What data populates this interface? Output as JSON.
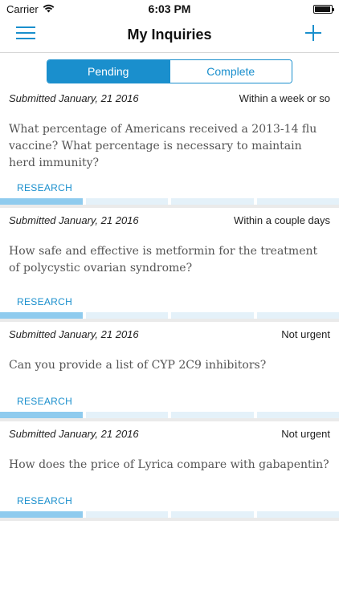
{
  "status_bar": {
    "carrier": "Carrier",
    "time": "6:03 PM",
    "battery_level": 0.95
  },
  "nav": {
    "title": "My Inquiries",
    "menu_icon": "menu-icon",
    "add_icon": "plus-icon"
  },
  "segments": {
    "pending": "Pending",
    "complete": "Complete",
    "selected": "Pending"
  },
  "colors": {
    "accent": "#1a8fcd",
    "progress_on": "#8fcbee",
    "progress_off": "#e4f1f9"
  },
  "inquiries": [
    {
      "submitted": "Submitted January, 21 2016",
      "urgency": "Within a week or so",
      "question": "What percentage of Americans received a 2013-14 flu vaccine? What percentage is necessary to maintain herd immunity?",
      "stage": "RESEARCH",
      "progress_steps_done": 1,
      "progress_steps_total": 4
    },
    {
      "submitted": "Submitted January, 21 2016",
      "urgency": "Within a couple days",
      "question": "How safe and effective is metformin for the treatment of polycystic ovarian syndrome?",
      "stage": "RESEARCH",
      "progress_steps_done": 1,
      "progress_steps_total": 4
    },
    {
      "submitted": "Submitted January, 21 2016",
      "urgency": "Not urgent",
      "question": "Can you provide a list of CYP 2C9 inhibitors?",
      "stage": "RESEARCH",
      "progress_steps_done": 1,
      "progress_steps_total": 4
    },
    {
      "submitted": "Submitted January, 21 2016",
      "urgency": "Not urgent",
      "question": "How does the price of Lyrica compare with gabapentin?",
      "stage": "RESEARCH",
      "progress_steps_done": 1,
      "progress_steps_total": 4
    }
  ]
}
